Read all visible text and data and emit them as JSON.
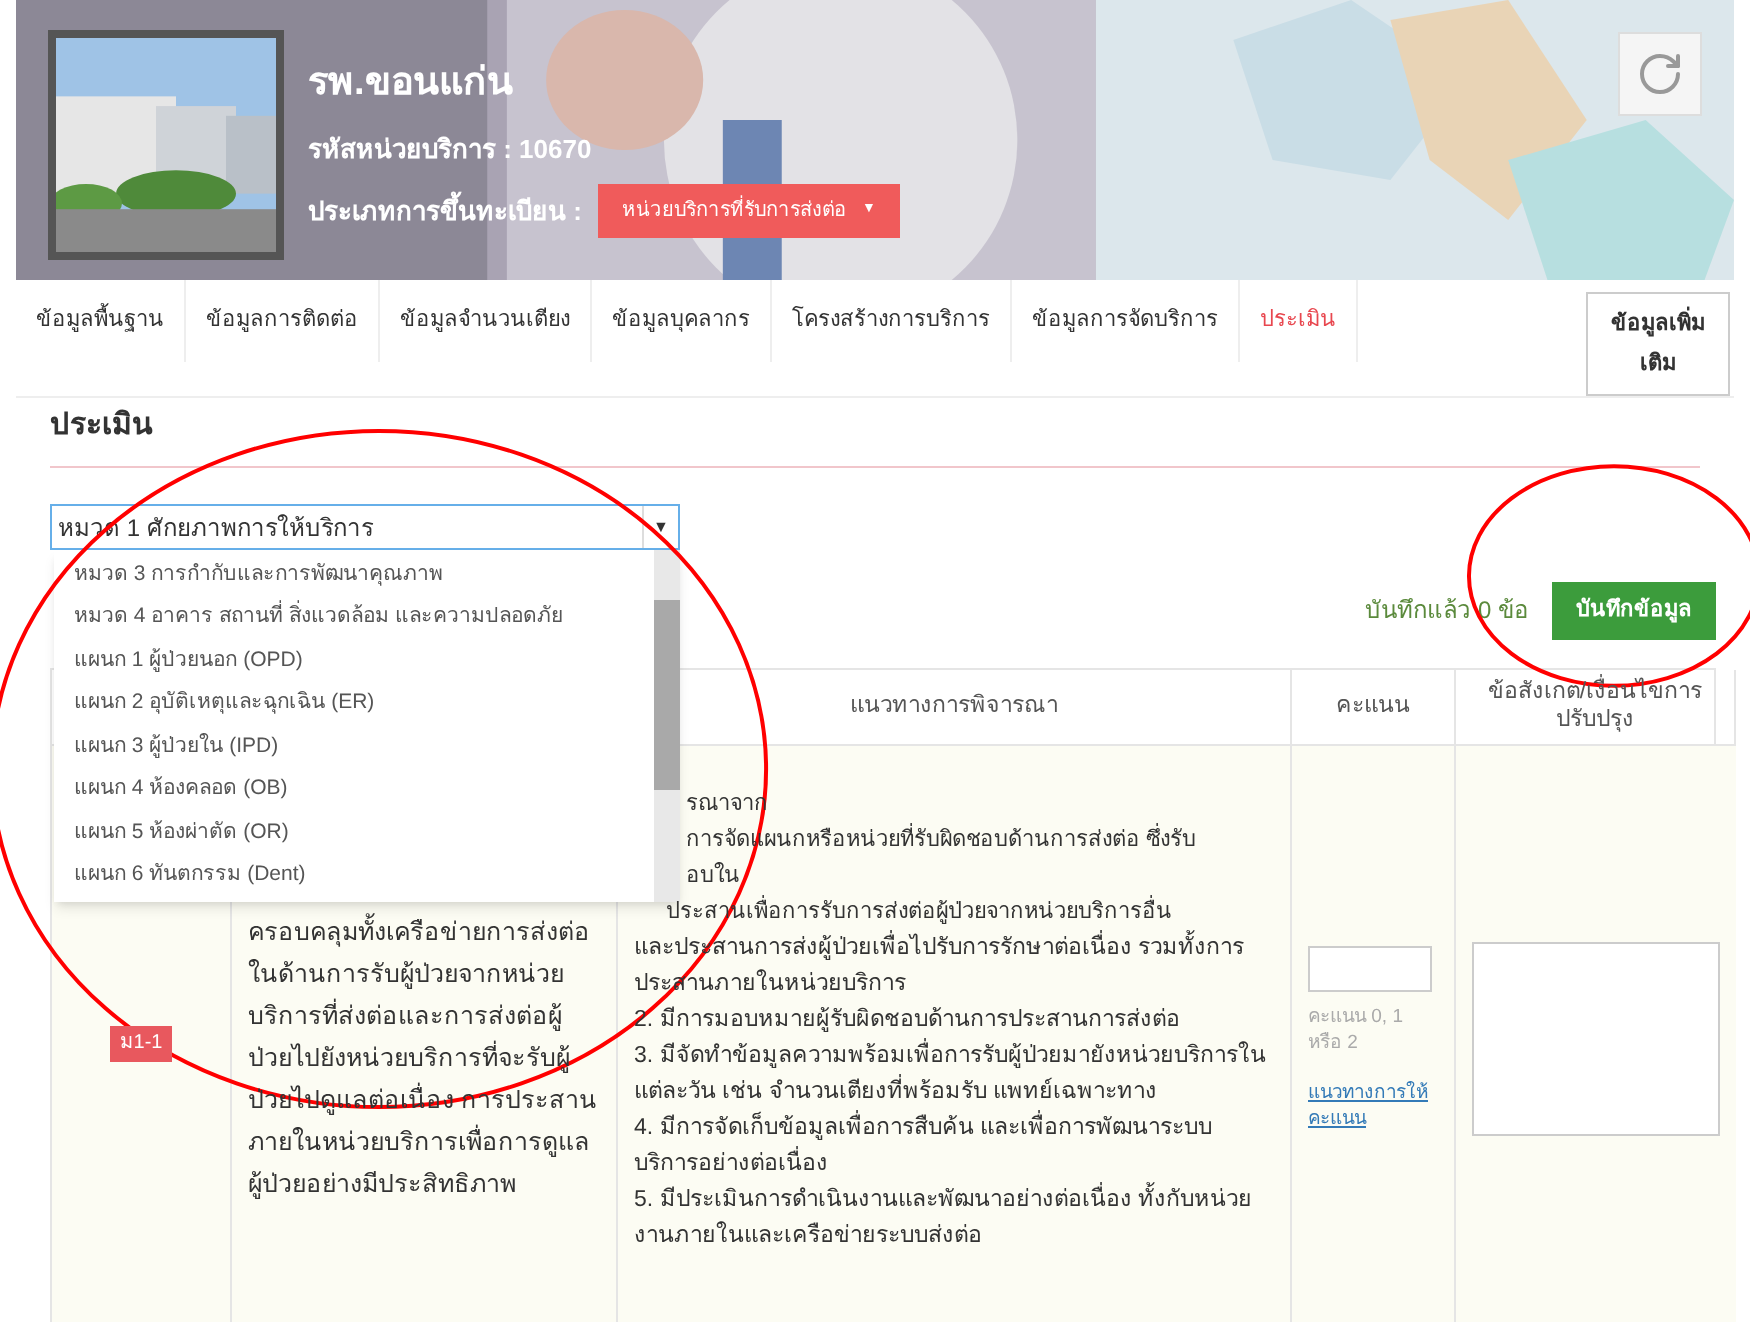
{
  "header": {
    "title": "รพ.ขอนแก่น",
    "code_label": "รหัสหน่วยบริการ : 10670",
    "type_label": "ประเภทการขึ้นทะเบียน :",
    "type_value": "หน่วยบริการที่รับการส่งต่อ",
    "type_caret": "▼"
  },
  "tabs": [
    {
      "label": "ข้อมูลพื้นฐาน",
      "selected": false
    },
    {
      "label": "ข้อมูลการติดต่อ",
      "selected": false
    },
    {
      "label": "ข้อมูลจำนวนเตียง",
      "selected": false
    },
    {
      "label": "ข้อมูลบุคลากร",
      "selected": false
    },
    {
      "label": "โครงสร้างการบริการ",
      "selected": false
    },
    {
      "label": "ข้อมูลการจัดบริการ",
      "selected": false
    },
    {
      "label": "ประเมิน",
      "selected": true
    }
  ],
  "more_button": "ข้อมูลเพิ่มเติม",
  "section_title": "ประเมิน",
  "select": {
    "value": "หมวด 1 ศักยภาพการให้บริการ",
    "expanded": true,
    "options": [
      {
        "label": "หมวด 3 การกำกับและการพัฒนาคุณภาพ",
        "selected": false
      },
      {
        "label": "หมวด 4 อาคาร สถานที่ สิ่งแวดล้อม และความปลอดภัย",
        "selected": false
      },
      {
        "label": "แผนก 1 ผู้ป่วยนอก (OPD)",
        "selected": false
      },
      {
        "label": "แผนก 2 อุบัติเหตุและฉุกเฉิน (ER)",
        "selected": false
      },
      {
        "label": "แผนก 3 ผู้ป่วยใน (IPD)",
        "selected": false
      },
      {
        "label": "แผนก 4 ห้องคลอด (OB)",
        "selected": false
      },
      {
        "label": "แผนก 5 ห้องผ่าตัด (OR)",
        "selected": false
      },
      {
        "label": "แผนก 6 ทันตกรรม (Dent)",
        "selected": false
      }
    ]
  },
  "saved_count": "บันทึกแล้ว 0 ข้อ",
  "save_button": "บันทึกข้อมูล",
  "table": {
    "columns": [
      "แนวทางการพิจารณา",
      "คะแนน",
      "ข้อสังเกต/เงื่อนไขการปรับปรุง"
    ],
    "rows": [
      {
        "code": "ม1-1",
        "description": "ครอบคลุมทั้งเครือข่ายการส่งต่อในด้านการรับผู้ป่วยจากหน่วยบริการที่ส่งต่อและการส่งต่อผู้ป่วยไปยังหน่วยบริการที่จะรับผู้ป่วยไปดูแลต่อเนื่อง การประสานภายในหน่วยบริการเพื่อการดูแลผู้ป่วยอย่างมีประสิทธิภาพ",
        "guideline_partial": [
          "รณาจาก",
          "การจัดแผนกหรือหน่วยที่รับผิดชอบด้านการส่งต่อ ซึ่งรับ",
          "อบใน",
          "ประสานเพื่อการรับการส่งต่อผู้ป่วยจากหน่วยบริการอื่น"
        ],
        "guideline": [
          "และประสานการส่งผู้ป่วยเพื่อไปรับการรักษาต่อเนื่อง รวมทั้งการประสานภายในหน่วยบริการ",
          "2. มีการมอบหมายผู้รับผิดชอบด้านการประสานการส่งต่อ",
          "3. มีจัดทำข้อมูลความพร้อมเพื่อการรับผู้ป่วยมายังหน่วยบริการในแต่ละวัน เช่น จำนวนเตียงที่พร้อมรับ แพทย์เฉพาะทาง",
          "4. มีการจัดเก็บข้อมูลเพื่อการสืบค้น และเพื่อการพัฒนาระบบบริการอย่างต่อเนื่อง",
          "5. มีประเมินการดำเนินงานและพัฒนาอย่างต่อเนื่อง ทั้งกับหน่วยงานภายในและเครือข่ายระบบส่งต่อ"
        ],
        "score_hint": "คะแนน 0, 1 หรือ 2",
        "score_link": "แนวทางการให้คะแนน"
      }
    ]
  },
  "annotations": [
    {
      "kind": "circle",
      "color": "#ff0000"
    },
    {
      "kind": "circle",
      "color": "#ff0000"
    }
  ]
}
